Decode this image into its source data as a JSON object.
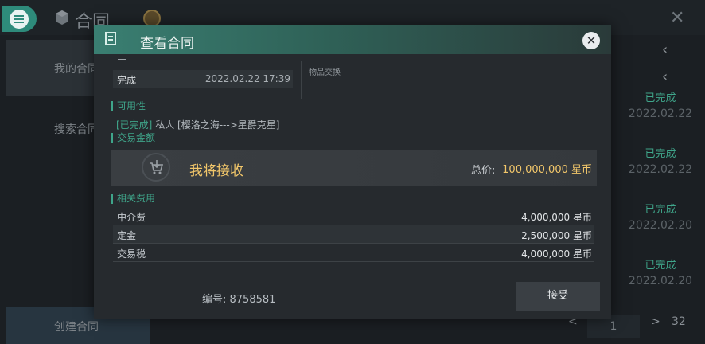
{
  "background": {
    "title": "合同",
    "sidebar": {
      "my_contracts": "我的合同",
      "search_contracts": "搜索合同",
      "create_contract": "创建合同"
    },
    "entries": [
      {
        "status": "已完成",
        "date": "2022.02.22"
      },
      {
        "status": "已完成",
        "date": "2022.02.22"
      },
      {
        "status": "已完成",
        "date": "2022.02.20"
      },
      {
        "status": "已完成",
        "date": "2022.02.20"
      }
    ],
    "pager": {
      "prev": "<",
      "page": "1",
      "next": ">",
      "total": "32"
    }
  },
  "modal": {
    "title": "查看合同",
    "status": {
      "label": "完成",
      "datetime": "2022.02.22 17:39"
    },
    "goods_exchange_label": "物品交换",
    "availability": {
      "label": "可用性",
      "tag": "[已完成]",
      "detail": "私人 [樱洛之海--->星爵克星]"
    },
    "amount": {
      "label": "交易金额",
      "receive_text": "我将接收",
      "total_label": "总价:",
      "total_value": "100,000,000 星币"
    },
    "fees": {
      "label": "相关费用",
      "rows": [
        {
          "name": "中介费",
          "value": "4,000,000 星币"
        },
        {
          "name": "定金",
          "value": "2,500,000 星币"
        },
        {
          "name": "交易税",
          "value": "4,000,000 星币"
        }
      ]
    },
    "code_line": "编号: 8758581",
    "accept_label": "接受"
  },
  "colors": {
    "accent": "#3fa58a",
    "gold": "#f1c66a",
    "header": "#3a7f72"
  }
}
